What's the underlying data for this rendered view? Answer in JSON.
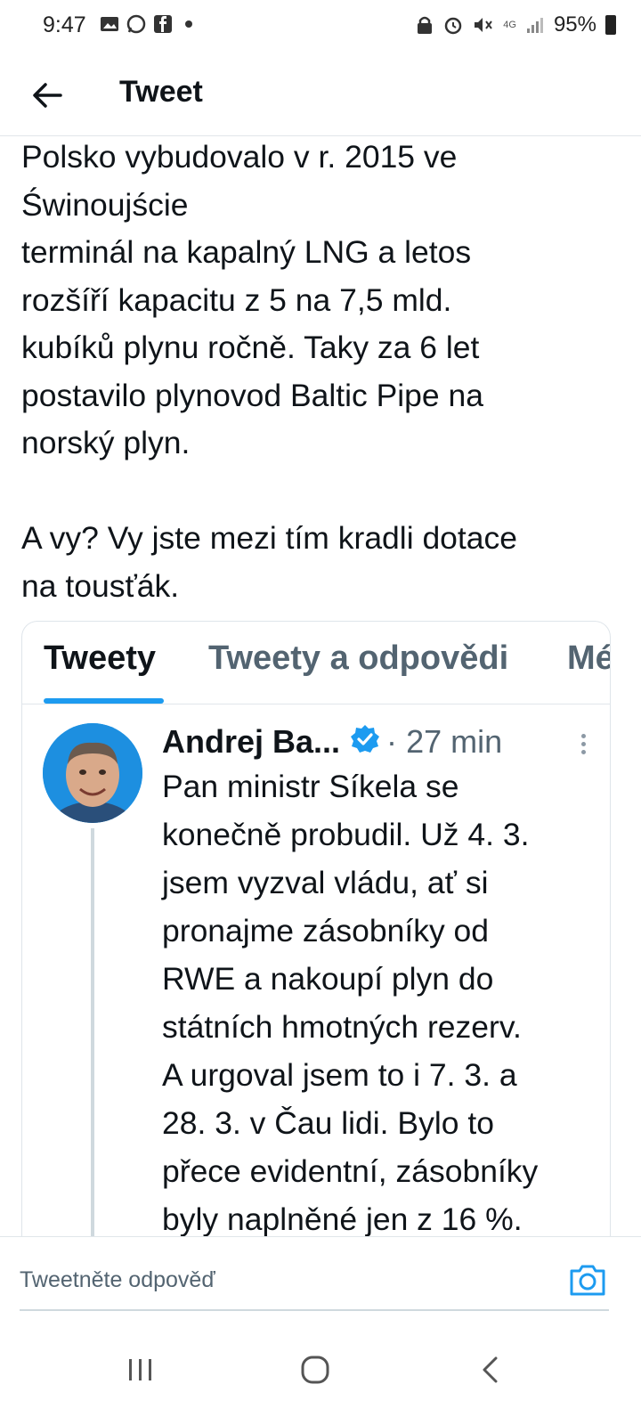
{
  "status_bar": {
    "time": "9:47",
    "network": "4G",
    "battery": "95%"
  },
  "header": {
    "title": "Tweet"
  },
  "tweet": {
    "text": "Polsko vybudovalo v r. 2015 ve\nŚwinoujście\nterminál na kapalný LNG a letos\nrozšíří kapacitu z 5 na 7,5 mld.\nkubíků plynu ročně. Taky za 6 let\npostavilo plynovod Baltic Pipe na\nnorský plyn.\n\nA vy? Vy jste mezi tím kradli dotace\nna tousťák."
  },
  "embedded": {
    "tabs": [
      "Tweety",
      "Tweety a odpovědi",
      "Mé"
    ],
    "inner_tweet": {
      "author": "Andrej Ba...",
      "separator": "·",
      "time": "27 min",
      "text": "Pan ministr Síkela se\nkonečně probudil. Už 4. 3.\njsem vyzval vládu, ať si\npronajme zásobníky od\nRWE a nakoupí plyn do\nstátních hmotných rezerv.\nA urgoval jsem to i 7. 3. a\n28. 3. v Čau lidi. Bylo to\npřece evidentní, zásobníky\nbyly naplněné jen z 16 %."
    }
  },
  "reply": {
    "placeholder": "Tweetněte odpověď"
  },
  "colors": {
    "accent": "#1d9bf0",
    "text": "#0f1419",
    "muted": "#536471",
    "divider": "#e1e6ea"
  },
  "icons": [
    "gallery-icon",
    "whatsapp-icon",
    "facebook-icon",
    "notification-dot-icon",
    "lock-icon",
    "alarm-icon",
    "mute-icon",
    "signal-icon",
    "battery-icon",
    "back-arrow-icon",
    "verified-badge-icon",
    "more-vertical-icon",
    "camera-icon",
    "recent-apps-icon",
    "home-icon",
    "back-nav-icon"
  ]
}
